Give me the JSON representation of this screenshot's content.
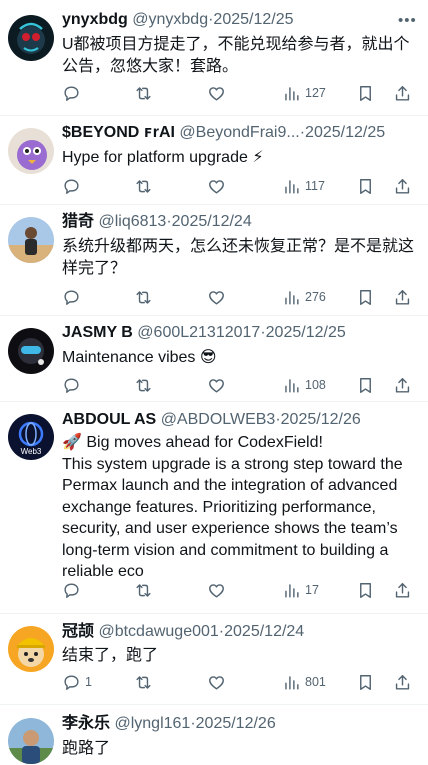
{
  "tweets": [
    {
      "name": "ynyxbdg",
      "handle": "@ynyxbdg",
      "date": "2025/12/25",
      "lines": [
        "U都被项目方提走了，不能兑现给参与者，就出个",
        "公告，忽悠大家！套路。"
      ],
      "replies": "",
      "reposts": "",
      "likes": "",
      "views": "127",
      "avatar": "dark-neon-creature"
    },
    {
      "name": "$BEYOND ꜰrAI",
      "handle": "@BeyondFrai9...",
      "date": "2025/12/25",
      "lines": [
        "Hype for platform upgrade ⚡"
      ],
      "replies": "",
      "reposts": "",
      "likes": "",
      "views": "117",
      "avatar": "purple-cartoon-bird"
    },
    {
      "name": "猎奇",
      "handle": "@liq6813",
      "date": "2025/12/24",
      "lines": [
        "系统升级都两天，怎么还未恢复正常？是不是就这",
        "样完了？"
      ],
      "replies": "",
      "reposts": "",
      "likes": "",
      "views": "276",
      "avatar": "person-in-desert"
    },
    {
      "name": "JASMY B",
      "handle": "@600L21312017",
      "date": "2025/12/25",
      "lines": [
        "Maintenance vibes 😎"
      ],
      "replies": "",
      "reposts": "",
      "likes": "",
      "views": "108",
      "avatar": "dark-robot-vr"
    },
    {
      "name": "ABDOUL AS",
      "handle": "@ABDOLWEB3",
      "date": "2025/12/26",
      "lines": [
        "🚀 Big moves ahead for CodexField!",
        "This system upgrade is a strong step toward the",
        "Permax launch and the integration of advanced",
        "exchange features. Prioritizing performance,",
        "security, and user experience shows the team’s",
        "long-term vision and commitment to building a",
        "reliable eco"
      ],
      "replies": "",
      "reposts": "",
      "likes": "",
      "views": "17",
      "avatar": "web3-globe-logo",
      "avatar_text": "Web3"
    },
    {
      "name": "冠颉",
      "handle": "@btcdawuge001",
      "date": "2025/12/24",
      "lines": [
        "结束了，跑了"
      ],
      "replies": "1",
      "reposts": "",
      "likes": "",
      "views": "801",
      "avatar": "shiba-dog-hardhat"
    },
    {
      "name": "李永乐",
      "handle": "@lyngl161",
      "date": "2025/12/26",
      "lines": [
        "跑路了"
      ],
      "replies": "",
      "reposts": "",
      "likes": "",
      "views": "",
      "avatar": "man-outdoors"
    }
  ],
  "separator": "·",
  "more_glyph": "•••",
  "colors": {
    "text": "#0f1419",
    "muted": "#536471",
    "divider": "#eff3f4",
    "background": "#ffffff"
  },
  "icons": [
    "reply-icon",
    "repost-icon",
    "like-icon",
    "views-icon",
    "bookmark-icon",
    "share-icon",
    "more-icon"
  ]
}
